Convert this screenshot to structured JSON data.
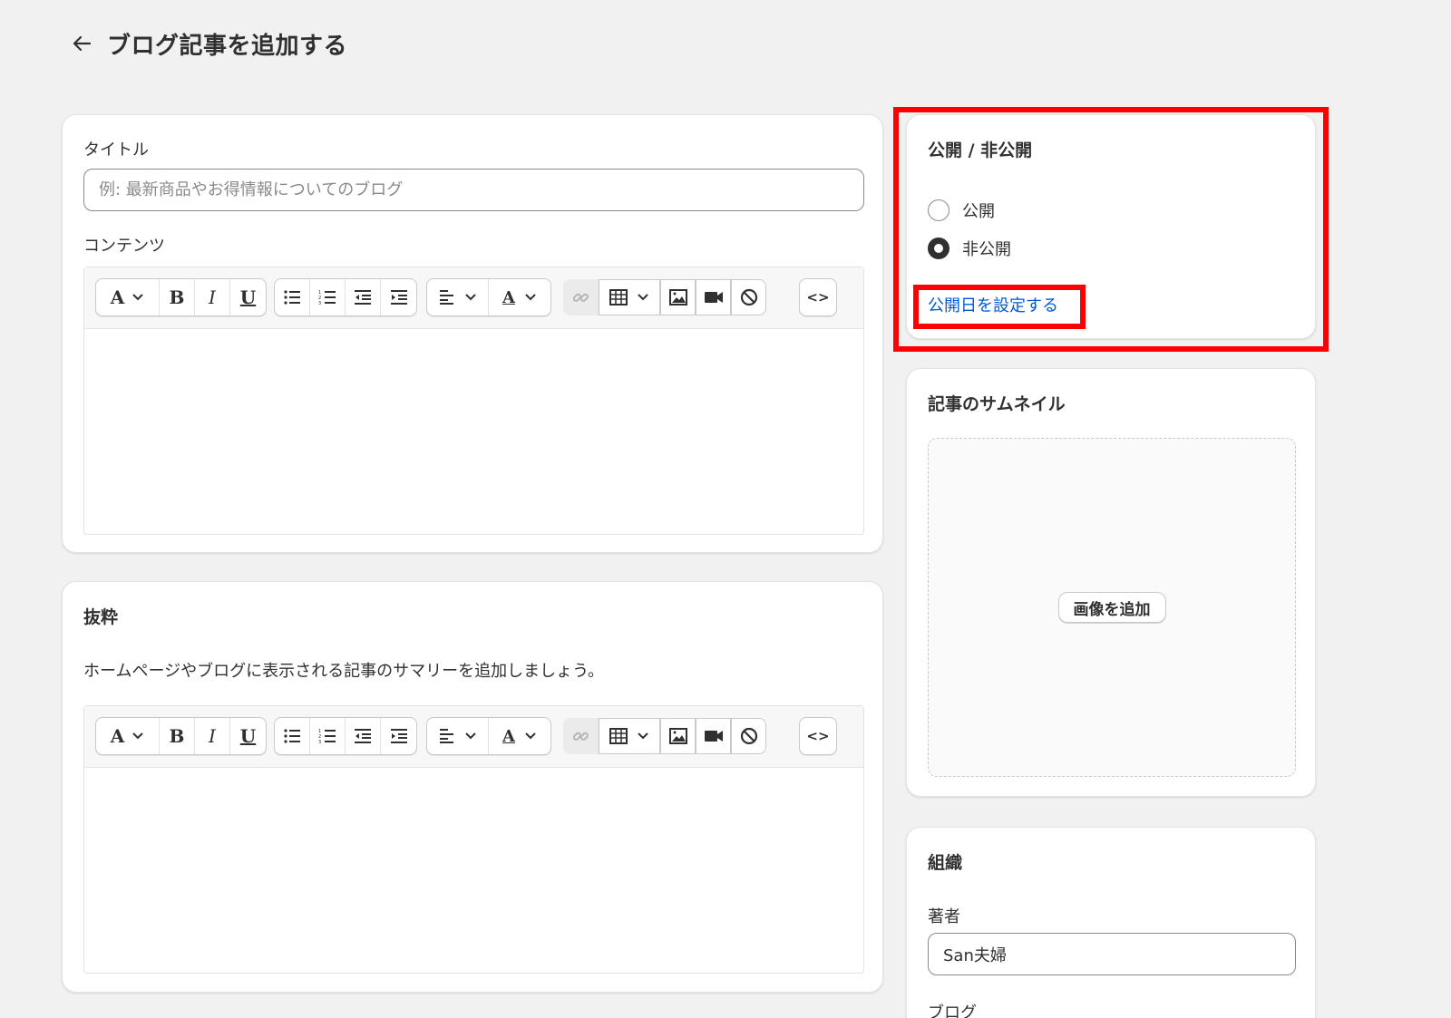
{
  "header": {
    "title": "ブログ記事を追加する"
  },
  "main_card": {
    "title_label": "タイトル",
    "title_placeholder": "例: 最新商品やお得情報についてのブログ",
    "content_label": "コンテンツ"
  },
  "excerpt_card": {
    "heading": "抜粋",
    "description": "ホームページやブログに表示される記事のサマリーを追加しましょう。"
  },
  "toolbar": {
    "font_button": "A",
    "bold_button": "B",
    "italic_button": "I",
    "underline_button": "U",
    "text_color_button": "A",
    "html_button": "<>"
  },
  "visibility_card": {
    "heading": "公開 / 非公開",
    "options": [
      {
        "label": "公開",
        "checked": false
      },
      {
        "label": "非公開",
        "checked": true
      }
    ],
    "set_date_link": "公開日を設定する"
  },
  "thumbnail_card": {
    "heading": "記事のサムネイル",
    "add_image_button": "画像を追加"
  },
  "organization_card": {
    "heading": "組織",
    "author_label": "著者",
    "author_value": "San夫婦",
    "blog_label": "ブログ"
  },
  "colors": {
    "background": "#f1f1f1",
    "card": "#ffffff",
    "link": "#005bd3",
    "highlight": "#ff0000"
  }
}
